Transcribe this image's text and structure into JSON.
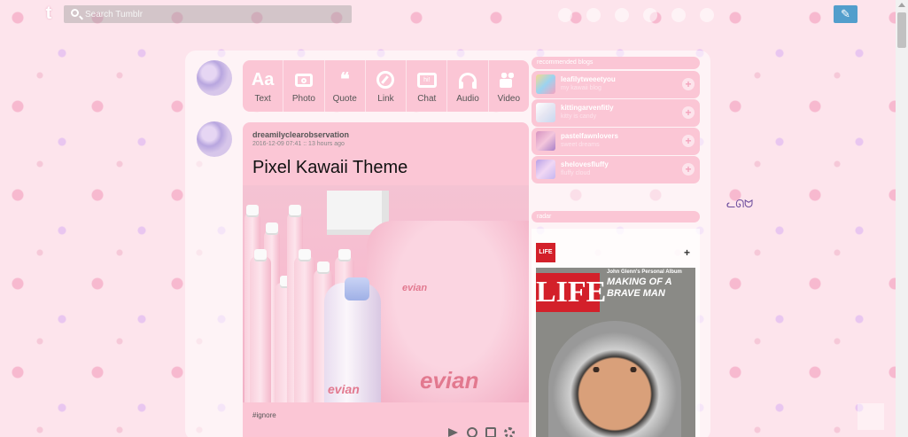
{
  "header": {
    "logo": "t",
    "search_placeholder": "Search Tumblr",
    "compose_icon": "pencil-icon"
  },
  "post_types": [
    {
      "label": "Text",
      "icon": "text-icon",
      "glyph": "Aa"
    },
    {
      "label": "Photo",
      "icon": "camera-icon"
    },
    {
      "label": "Quote",
      "icon": "quote-icon",
      "glyph": "❝"
    },
    {
      "label": "Link",
      "icon": "link-icon"
    },
    {
      "label": "Chat",
      "icon": "chat-icon",
      "glyph": "hi!"
    },
    {
      "label": "Audio",
      "icon": "headphones-icon"
    },
    {
      "label": "Video",
      "icon": "video-camera-icon"
    }
  ],
  "post": {
    "author": "dreamilyclearobservation",
    "meta": "2016-12-09 07:41 :: 13 hours ago",
    "title": "Pixel Kawaii Theme",
    "image_text": {
      "big": "evian",
      "small": "evian",
      "bottle": "evian"
    },
    "tag": "#ignore"
  },
  "sidebar": {
    "recommended_header": "recommended blogs",
    "recommended": [
      {
        "name": "leafilytweeetyou",
        "sub": "my kawaii blog"
      },
      {
        "name": "kittingarvenfitly",
        "sub": "kitty is candy"
      },
      {
        "name": "pastelfawnlovers",
        "sub": "sweet dreams"
      },
      {
        "name": "shelovesfluffy",
        "sub": "fluffy cloud"
      }
    ],
    "follow_label": "+",
    "radar_header": "radar",
    "radar": {
      "badge": "LIFE",
      "follow_label": "+",
      "cover_mast": "LIFE",
      "cover_kicker": "John Glenn's Personal Album",
      "cover_headline": "MAKING OF A BRAVE MAN"
    }
  },
  "colors": {
    "panel_pink": "#fbc6d5",
    "compose_blue": "#529ecc",
    "life_red": "#d3202a"
  }
}
